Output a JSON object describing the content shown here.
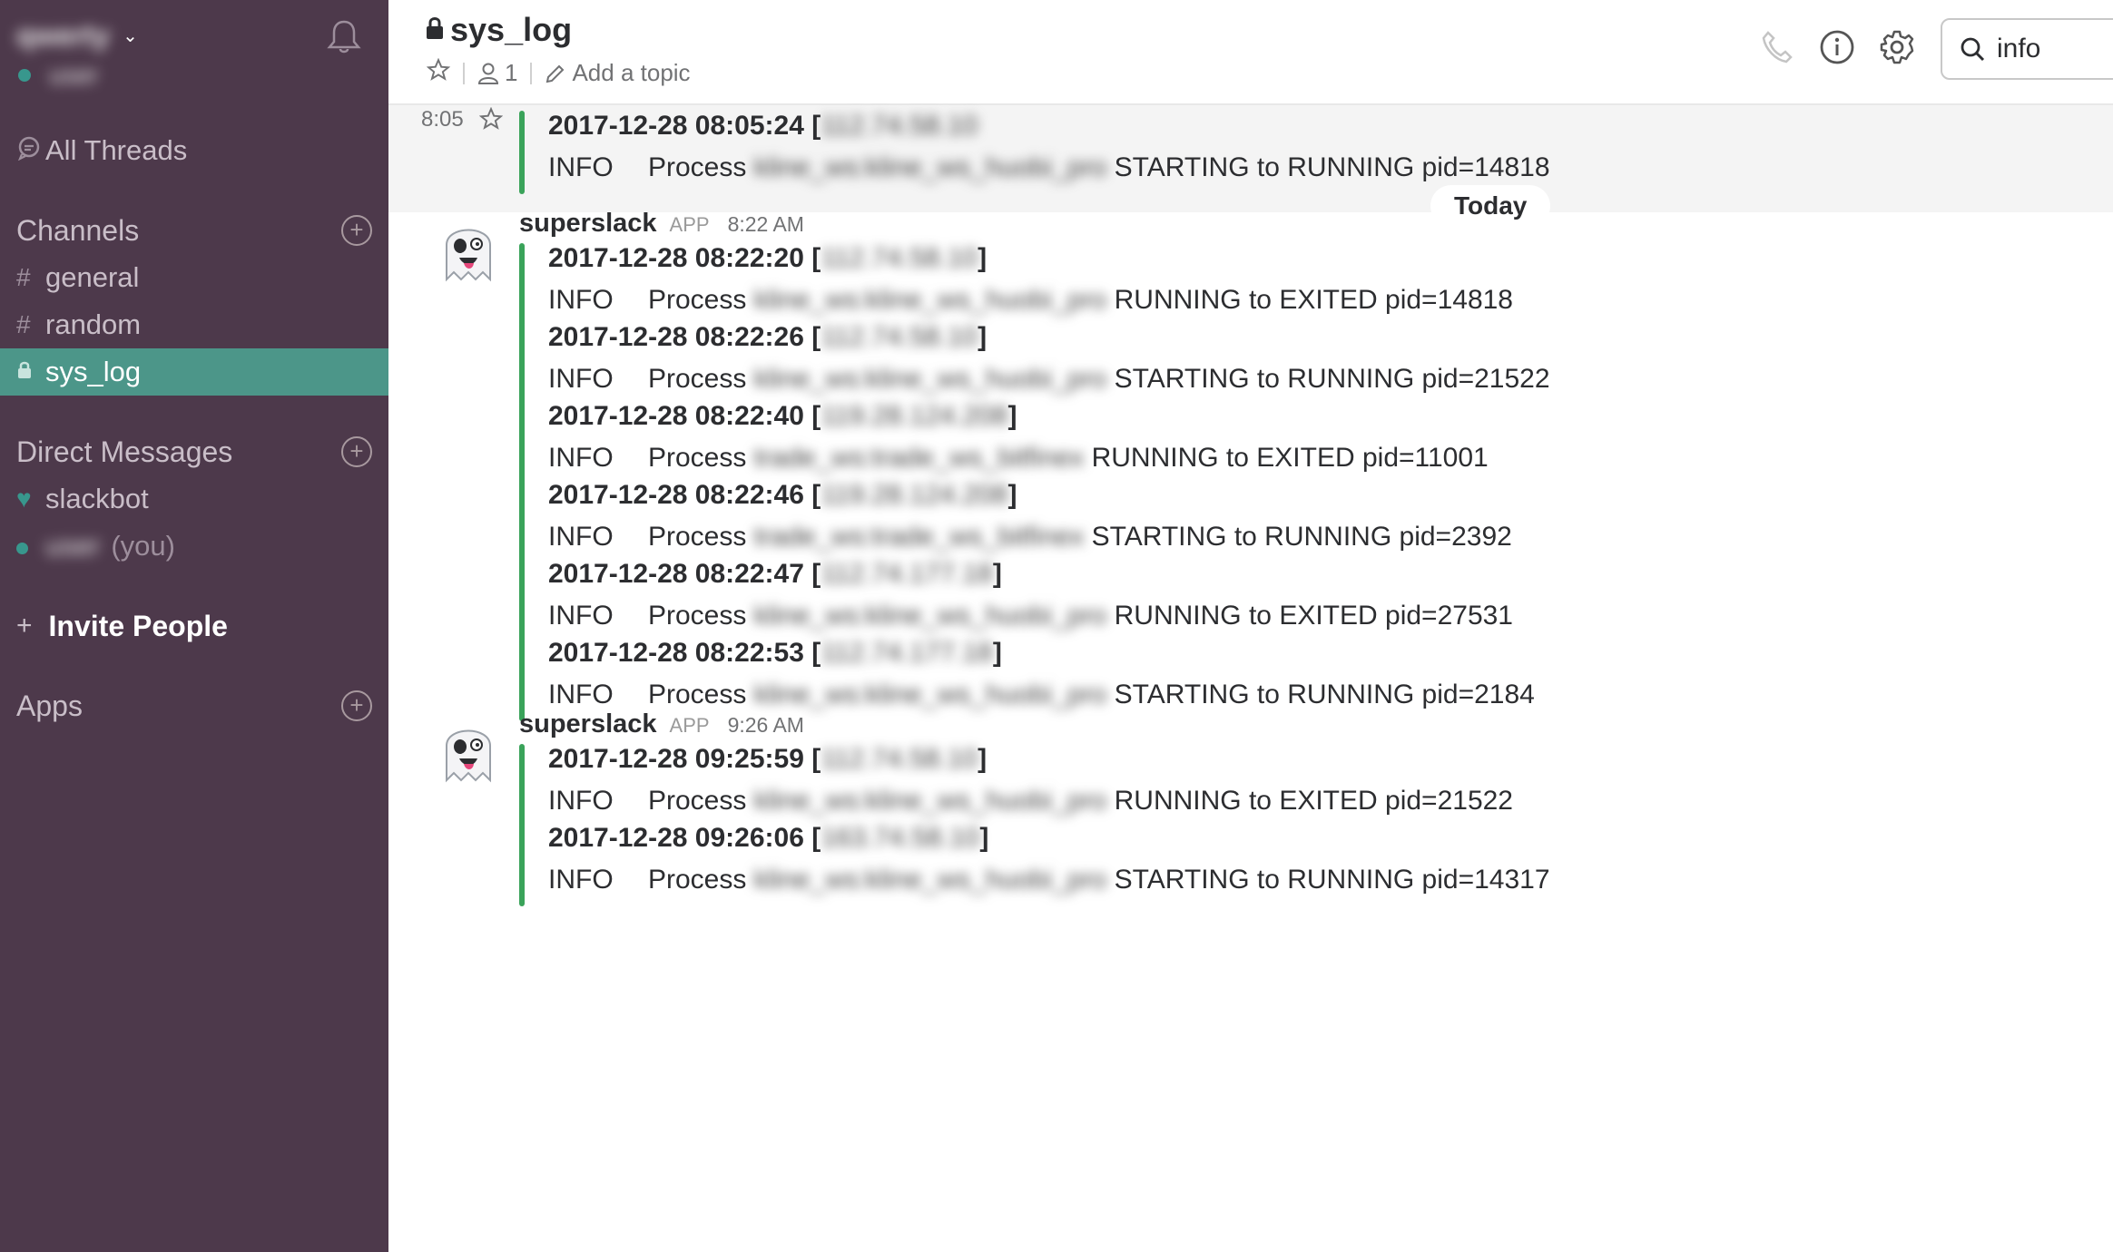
{
  "sidebar": {
    "team_name": "qwerty",
    "user_name": "user",
    "all_threads": "All Threads",
    "channels_header": "Channels",
    "channels": [
      {
        "prefix": "#",
        "label": "general"
      },
      {
        "prefix": "#",
        "label": "random"
      },
      {
        "prefix": "lock",
        "label": "sys_log",
        "active": true
      }
    ],
    "dm_header": "Direct Messages",
    "dms": [
      {
        "label": "slackbot"
      },
      {
        "label": "user",
        "suffix": "(you)"
      }
    ],
    "invite": "Invite People",
    "apps_header": "Apps"
  },
  "header": {
    "channel": "sys_log",
    "member_count": "1",
    "add_topic": "Add a topic",
    "search_value": "info"
  },
  "day_divider": "Today",
  "first_message": {
    "time": "8:05",
    "timestamp": "2017-12-28 08:05:24 [",
    "ip": "112.74.58.10",
    "level": "INFO",
    "process_prefix": "Process",
    "process_name": "kline_ws:kline_ws_huobi_pro",
    "status": "STARTING to RUNNING pid=14818"
  },
  "groups": [
    {
      "sender": "superslack",
      "badge": "APP",
      "time": "8:22 AM",
      "entries": [
        {
          "timestamp": "2017-12-28 08:22:20 [",
          "ip": "112.74.58.10",
          "close": "]",
          "level": "INFO",
          "process_prefix": "Process",
          "process_name": "kline_ws:kline_ws_huobi_pro",
          "status": "RUNNING to EXITED pid=14818"
        },
        {
          "timestamp": "2017-12-28 08:22:26 [",
          "ip": "112.74.58.10",
          "close": "]",
          "level": "INFO",
          "process_prefix": "Process",
          "process_name": "kline_ws:kline_ws_huobi_pro",
          "status": "STARTING to RUNNING pid=21522"
        },
        {
          "timestamp": "2017-12-28 08:22:40 [",
          "ip": "119.28.124.208",
          "close": "]",
          "level": "INFO",
          "process_prefix": "Process",
          "process_name": "trade_ws:trade_ws_bitfinex",
          "status": "RUNNING to EXITED pid=11001"
        },
        {
          "timestamp": "2017-12-28 08:22:46 [",
          "ip": "119.28.124.208",
          "close": "]",
          "level": "INFO",
          "process_prefix": "Process",
          "process_name": "trade_ws:trade_ws_bitfinex",
          "status": "STARTING to RUNNING pid=2392"
        },
        {
          "timestamp": "2017-12-28 08:22:47 [",
          "ip": "112.74.177.18",
          "close": "]",
          "level": "INFO",
          "process_prefix": "Process",
          "process_name": "kline_ws:kline_ws_huobi_pro",
          "status": "RUNNING to EXITED pid=27531"
        },
        {
          "timestamp": "2017-12-28 08:22:53 [",
          "ip": "112.74.177.18",
          "close": "]",
          "level": "INFO",
          "process_prefix": "Process",
          "process_name": "kline_ws:kline_ws_huobi_pro",
          "status": "STARTING to RUNNING pid=2184"
        }
      ]
    },
    {
      "sender": "superslack",
      "badge": "APP",
      "time": "9:26 AM",
      "entries": [
        {
          "timestamp": "2017-12-28 09:25:59 [",
          "ip": "112.74.58.10",
          "close": "]",
          "level": "INFO",
          "process_prefix": "Process",
          "process_name": "kline_ws:kline_ws_huobi_pro",
          "status": "RUNNING to EXITED pid=21522"
        },
        {
          "timestamp": "2017-12-28 09:26:06 [",
          "ip": "163.74.58.10",
          "close": "]",
          "level": "INFO",
          "process_prefix": "Process",
          "process_name": "kline_ws:kline_ws_huobi_pro",
          "status": "STARTING to RUNNING pid=14317"
        }
      ]
    }
  ],
  "colors": {
    "sidebar_bg": "#4d394b",
    "active_channel": "#4c9689",
    "presence": "#38978d",
    "attachment_bar": "#3aa35a"
  }
}
